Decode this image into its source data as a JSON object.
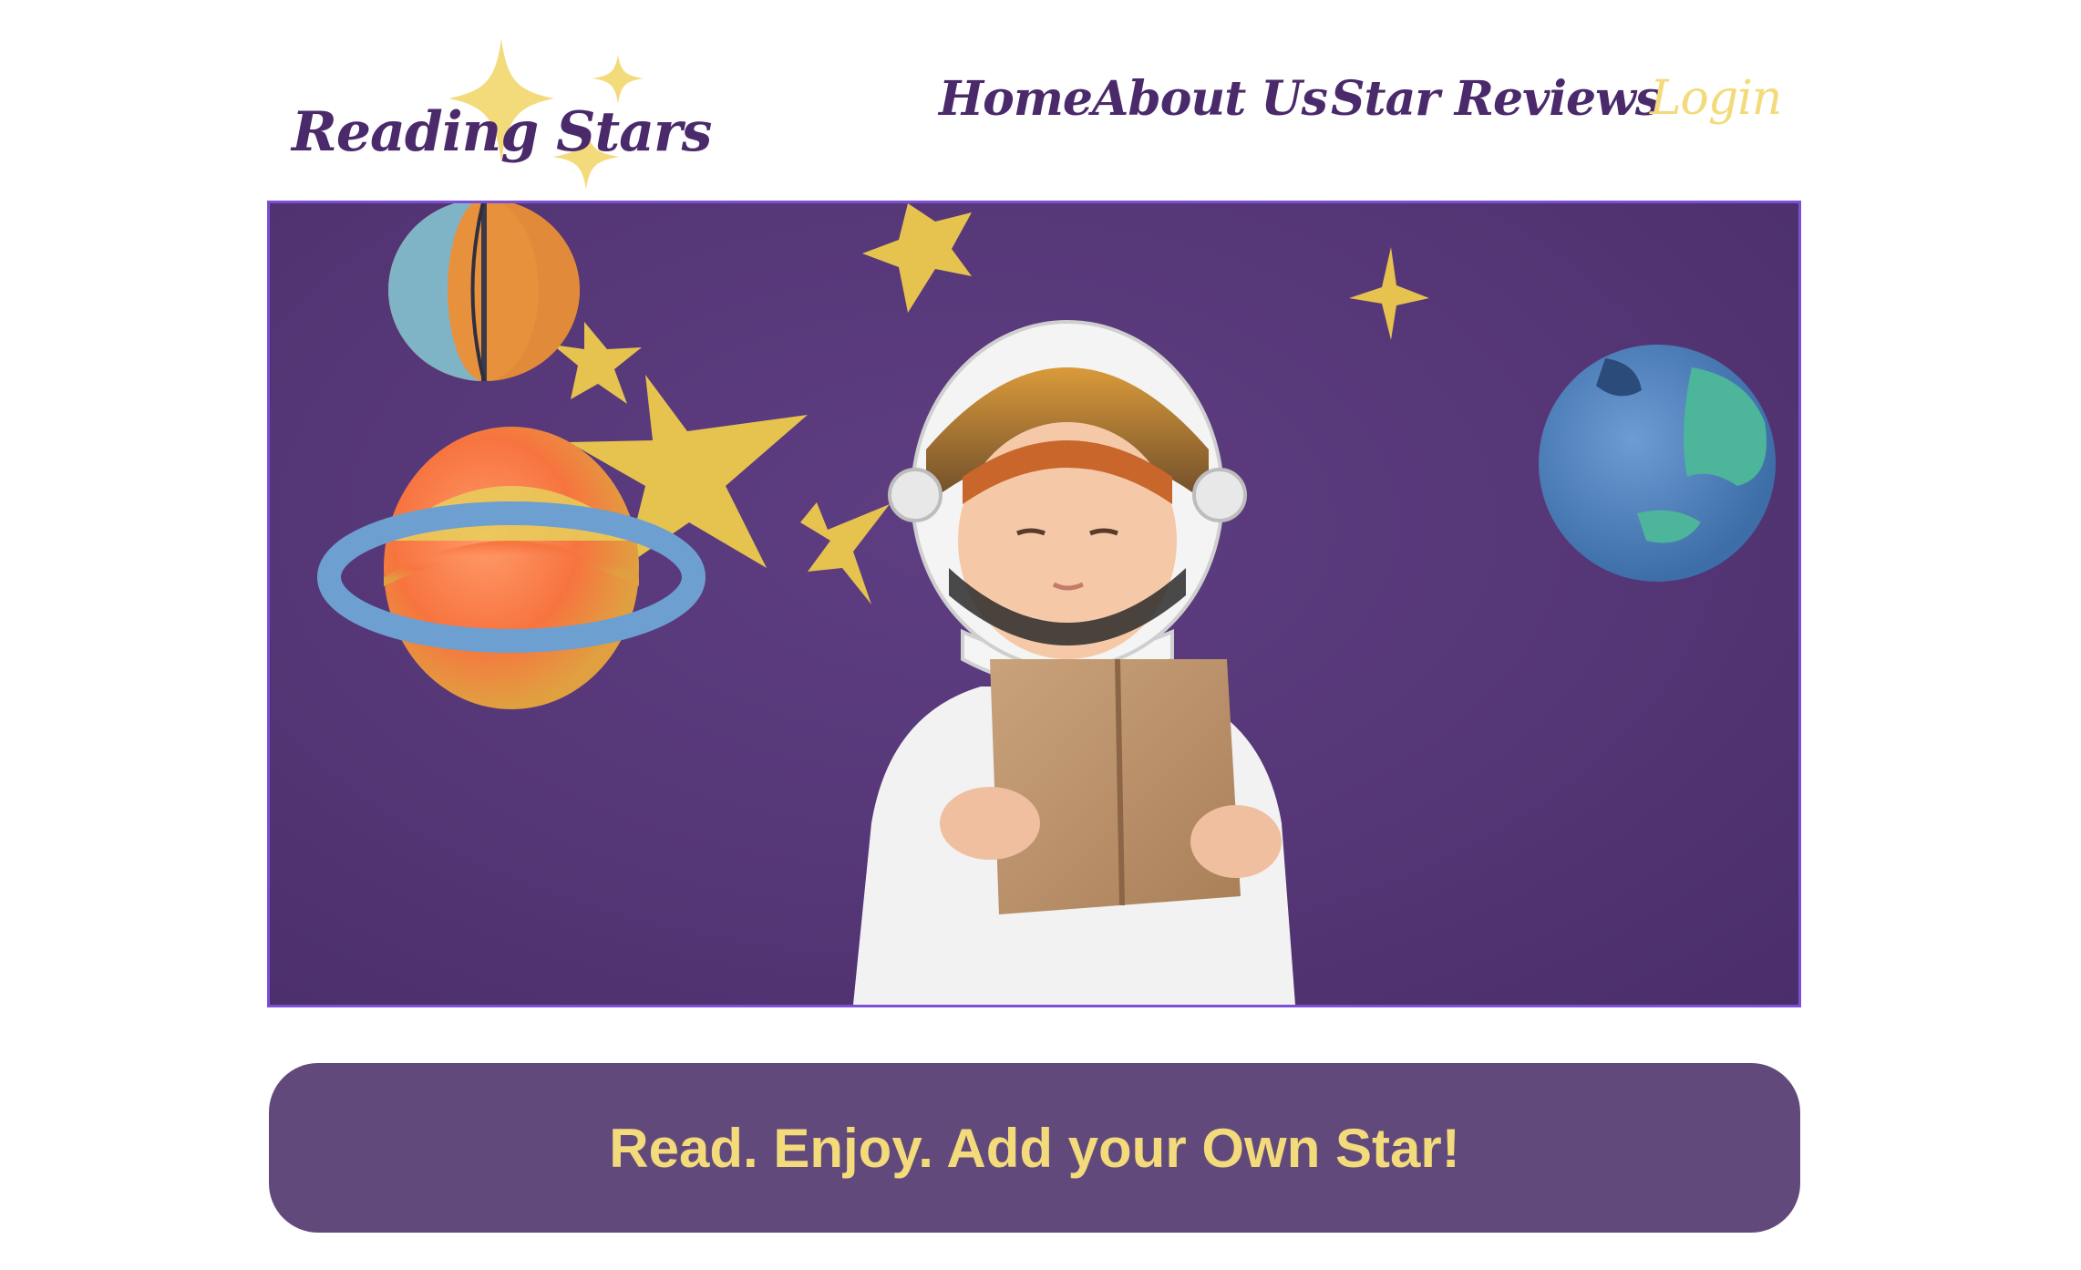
{
  "brand": {
    "name": "Reading Stars",
    "star_color": "#f3da7a",
    "text_color": "#4b2a6b"
  },
  "nav": {
    "items": [
      {
        "label": "Home"
      },
      {
        "label": "About Us"
      },
      {
        "label": "Star Reviews"
      },
      {
        "label": "Login"
      }
    ],
    "active_color": "#4b2a6b",
    "login_color": "#f3da7a"
  },
  "hero": {
    "image": "child-in-astronaut-helmet-reading-book",
    "background_color": "#553676",
    "border_color": "#7b4fd6"
  },
  "banner": {
    "text": "Read. Enjoy. Add your Own Star!",
    "background_color": "#614a7b",
    "text_color": "#f3da7a"
  }
}
